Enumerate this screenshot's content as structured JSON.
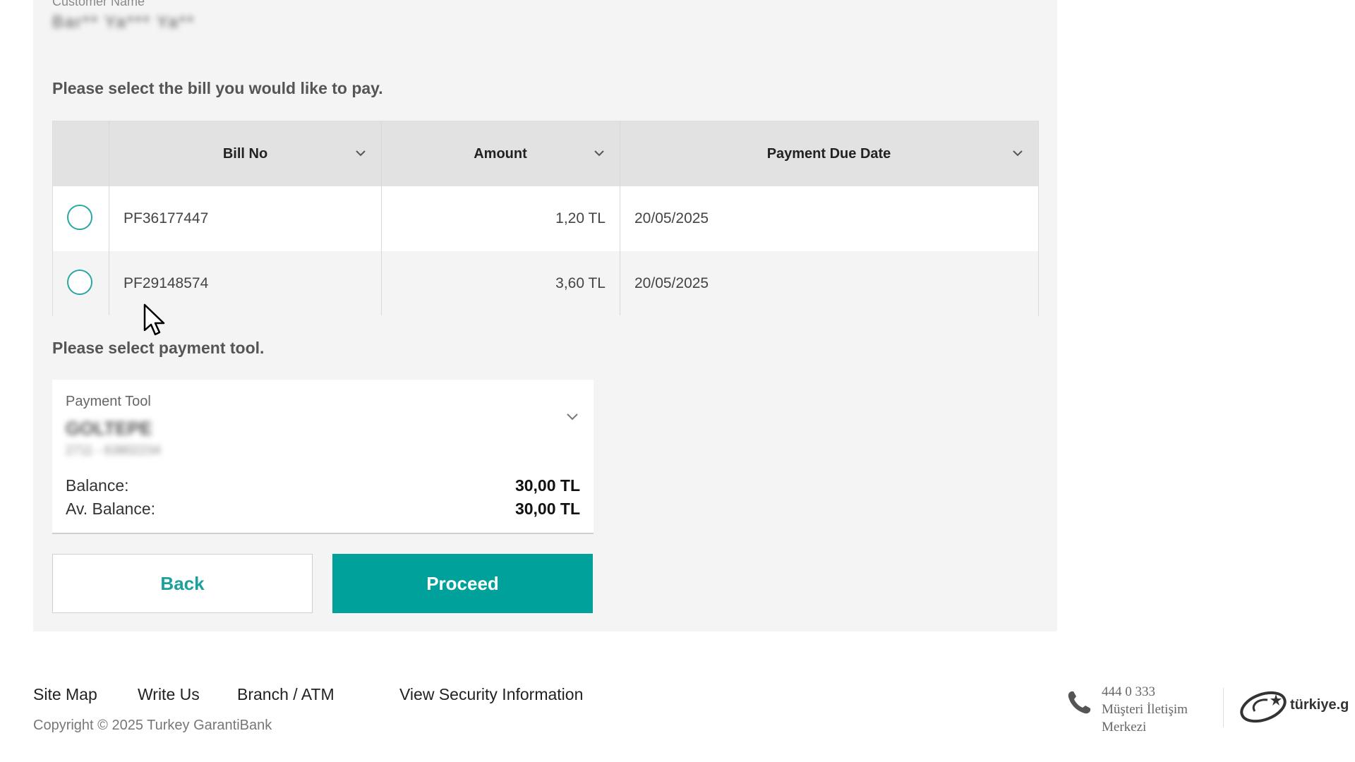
{
  "customer": {
    "label": "Customer Name",
    "name_blurred": "Bar** Ya*** Ya**"
  },
  "bill_section": {
    "instruction": "Please select the bill you would like to pay.",
    "columns": [
      "Bill No",
      "Amount",
      "Payment Due Date"
    ],
    "rows": [
      {
        "bill_no": "PF36177447",
        "amount": "1,20 TL",
        "due_date": "20/05/2025"
      },
      {
        "bill_no": "PF29148574",
        "amount": "3,60 TL",
        "due_date": "20/05/2025"
      }
    ]
  },
  "payment_tool": {
    "instruction": "Please select payment tool.",
    "label": "Payment Tool",
    "value_blurred": "GOLTEPE",
    "sub_blurred": "2711 - 63802234",
    "balance_label": "Balance:",
    "balance_value": "30,00 TL",
    "av_balance_label": "Av. Balance:",
    "av_balance_value": "30,00 TL"
  },
  "buttons": {
    "back": "Back",
    "proceed": "Proceed"
  },
  "footer": {
    "links": [
      "Site Map",
      "Write Us",
      "Branch / ATM",
      "View Security Information"
    ],
    "copyright": "Copyright © 2025 Turkey GarantiBank",
    "contact_phone": "444 0 333",
    "contact_line1": "Müşteri İletişim",
    "contact_line2": "Merkezi",
    "gov_logo_text": "türkiye.g"
  },
  "colors": {
    "accent": "#00a19b",
    "panel_bg": "#f4f4f4",
    "header_bg": "#e2e2e2"
  },
  "icons": [
    "chevron-down-icon",
    "radio-icon",
    "phone-icon",
    "mouse-cursor-icon"
  ]
}
